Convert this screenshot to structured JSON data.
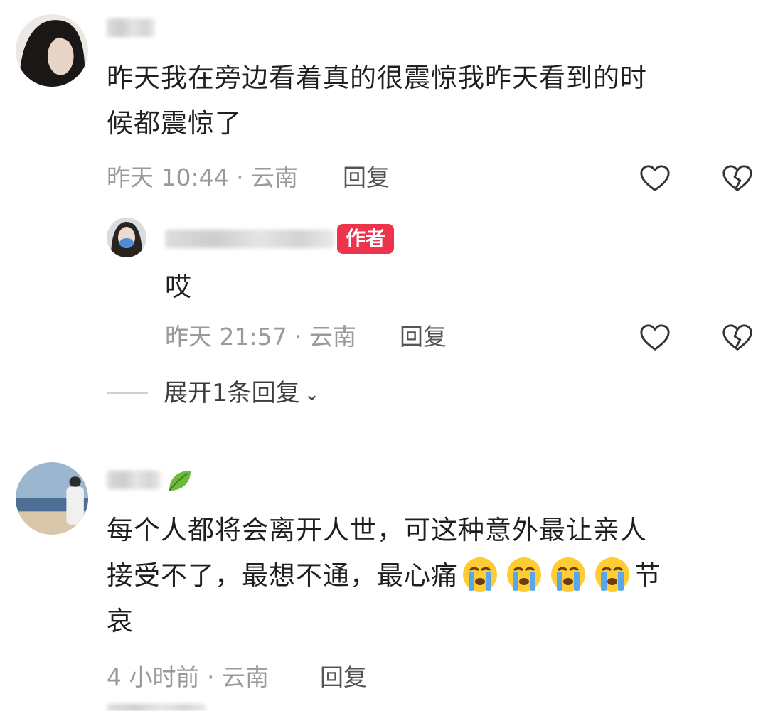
{
  "comments": [
    {
      "text_line1": "昨天我在旁边看着真的很震惊我昨天看到的时",
      "text_line2": "候都震惊了",
      "meta": "昨天 10:44 · 云南",
      "reply_label": "回复"
    },
    {
      "badge": "作者",
      "text": "哎",
      "meta": "昨天 21:57 · 云南",
      "reply_label": "回复"
    },
    {
      "text_line1": "每个人都将会离开人世，可这种意外最让亲人",
      "text_line2_prefix": "接受不了，最想不通，最心痛",
      "text_line2_suffix": "节",
      "text_line3": "哀",
      "emoji": "loudly-crying-face",
      "emoji_count": 4,
      "meta": "4 小时前 · 云南",
      "reply_label": "回复"
    }
  ],
  "expand_replies": "展开1条回复",
  "colors": {
    "badge": "#f0334d",
    "meta": "#9a9a9a"
  },
  "icons": {
    "like": "heart-outline-icon",
    "dislike": "broken-heart-icon",
    "chevron": "chevron-down-icon",
    "leaf": "leaf-icon"
  }
}
